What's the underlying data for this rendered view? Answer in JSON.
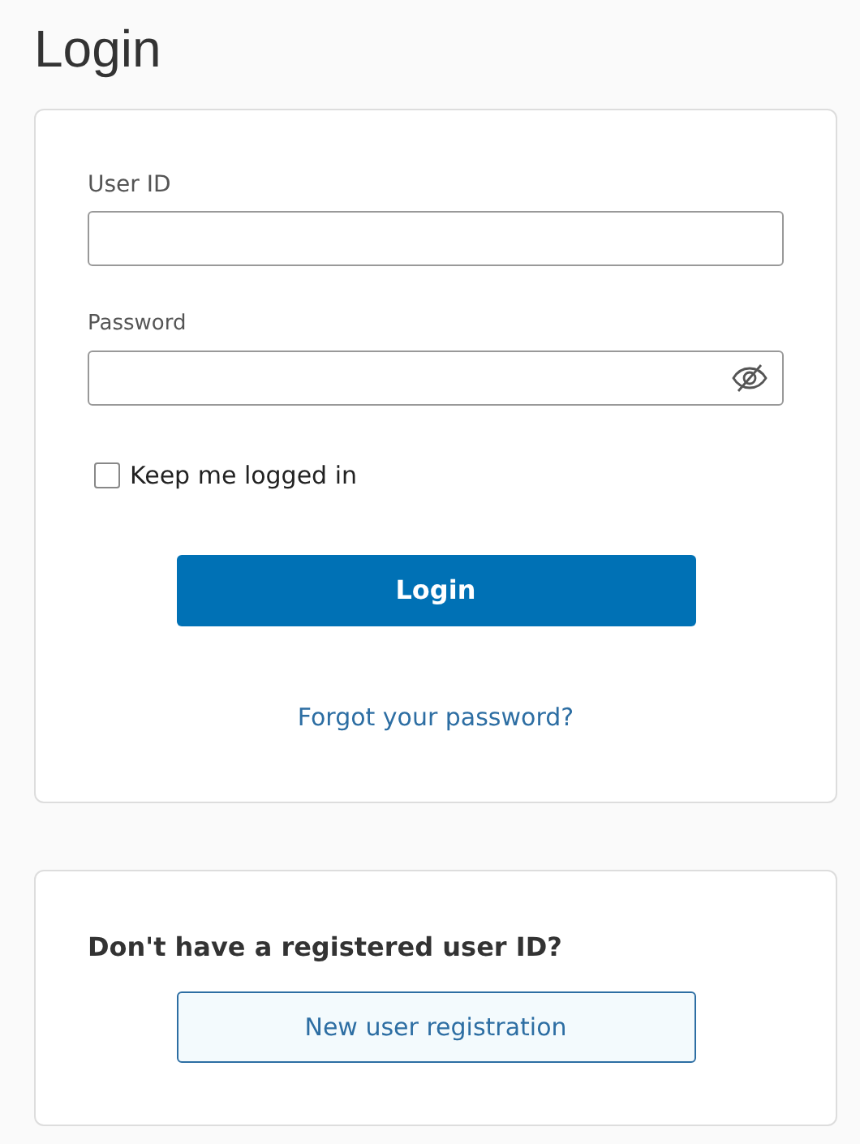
{
  "title": "Login",
  "login_form": {
    "user_id": {
      "label": "User ID"
    },
    "password": {
      "label": "Password",
      "visible": false
    },
    "keep_logged_in": {
      "label": "Keep me logged in",
      "checked": false
    },
    "login_button": "Login",
    "forgot_link": "Forgot your password?"
  },
  "registration": {
    "heading": "Don't have a registered user ID?",
    "button": "New user registration"
  }
}
